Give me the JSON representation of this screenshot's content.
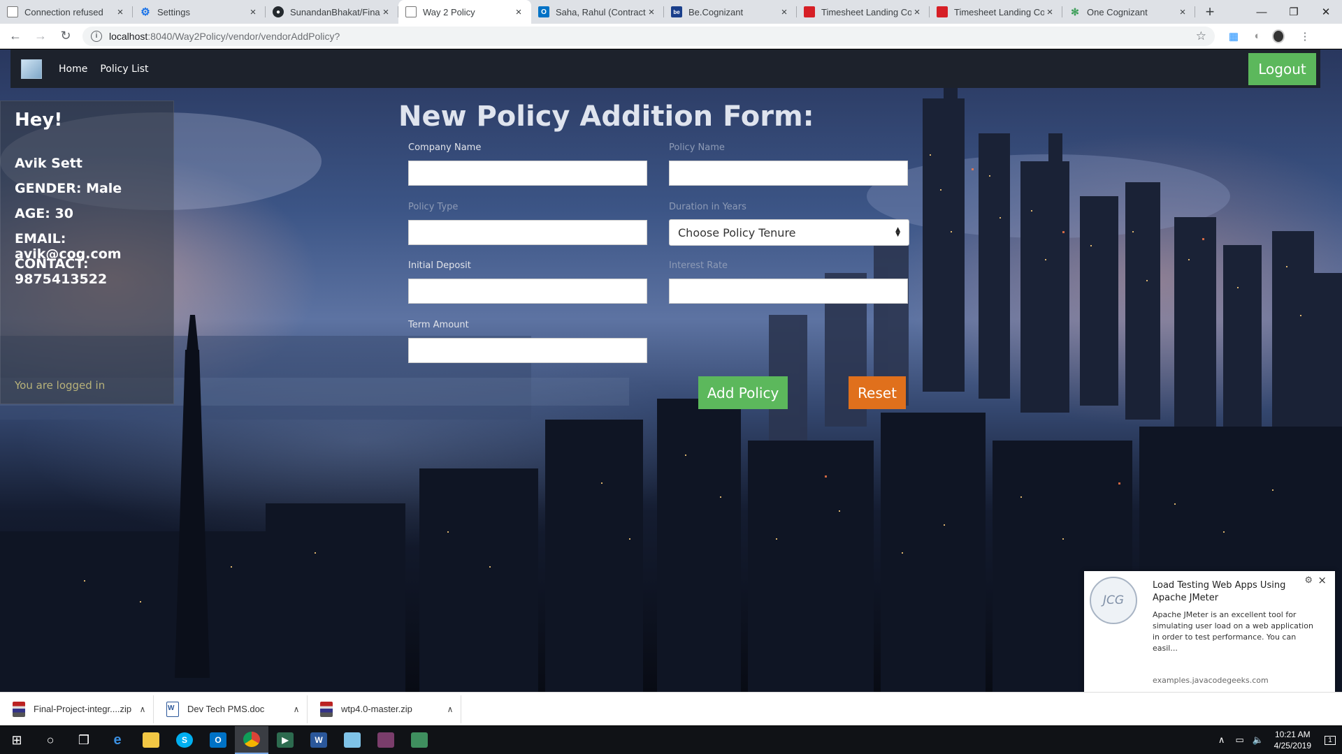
{
  "browser": {
    "tabs": [
      {
        "title": "Connection refused",
        "favicon": "page-icon",
        "favicon_color": "#ffffff",
        "active": false
      },
      {
        "title": "Settings",
        "favicon": "gear-icon",
        "favicon_color": "#1a73e8",
        "active": false
      },
      {
        "title": "SunandanBhakat/Final-",
        "favicon": "github-icon",
        "favicon_color": "#24292e",
        "active": false
      },
      {
        "title": "Way 2 Policy",
        "favicon": "page-icon",
        "favicon_color": "#ffffff",
        "active": true
      },
      {
        "title": "Saha, Rahul (Contracto",
        "favicon": "outlook-icon",
        "favicon_color": "#0072c6",
        "active": false
      },
      {
        "title": "Be.Cognizant",
        "favicon": "be-icon",
        "favicon_color": "#1a3f8b",
        "active": false
      },
      {
        "title": "Timesheet Landing Co",
        "favicon": "timesheet-icon",
        "favicon_color": "#d61f26",
        "active": false
      },
      {
        "title": "Timesheet Landing Co",
        "favicon": "timesheet-icon",
        "favicon_color": "#d61f26",
        "active": false
      },
      {
        "title": "One Cognizant",
        "favicon": "one-cognizant-icon",
        "favicon_color": "#3e9f5a",
        "active": false
      }
    ],
    "url_host": "localhost",
    "url_path": ":8040/Way2Policy/vendor/vendorAddPolicy?"
  },
  "navbar": {
    "links": [
      "Home",
      "Policy List"
    ],
    "logout_label": "Logout"
  },
  "profile": {
    "greeting": "Hey!",
    "name": "Avik  Sett",
    "gender": "GENDER: Male",
    "age": "AGE: 30",
    "email": "EMAIL: avik@cog.com",
    "contact": "CONTACT: 9875413522",
    "status": "You are logged in"
  },
  "form": {
    "title": "New Policy Addition Form:",
    "company_name_label": "Company Name",
    "company_name_value": "",
    "policy_name_label": "Policy Name",
    "policy_name_value": "",
    "policy_type_label": "Policy Type",
    "policy_type_value": "",
    "duration_label": "Duration in Years",
    "duration_selected": "Choose Policy Tenure",
    "initial_deposit_label": "Initial Deposit",
    "initial_deposit_value": "",
    "interest_rate_label": "Interest Rate",
    "interest_rate_value": "",
    "term_amount_label": "Term Amount",
    "term_amount_value": "",
    "add_button": "Add Policy",
    "reset_button": "Reset"
  },
  "notification": {
    "logo_text": "JCG",
    "title": "Load Testing Web Apps Using Apache JMeter",
    "body": "Apache JMeter is an excellent tool for simulating user load on a web application in order to test performance. You can easil...",
    "source": "examples.javacodegeeks.com"
  },
  "downloads": [
    {
      "name": "Final-Project-integr....zip",
      "icon": "archive-icon"
    },
    {
      "name": "Dev Tech PMS.doc",
      "icon": "word-doc-icon"
    },
    {
      "name": "wtp4.0-master.zip",
      "icon": "archive-icon"
    }
  ],
  "taskbar": {
    "time": "10:21 AM",
    "date": "4/25/2019",
    "notification_count": "1"
  },
  "colors": {
    "success": "#5cb85c",
    "warning": "#e0701c",
    "navbar": "#1d222c"
  }
}
